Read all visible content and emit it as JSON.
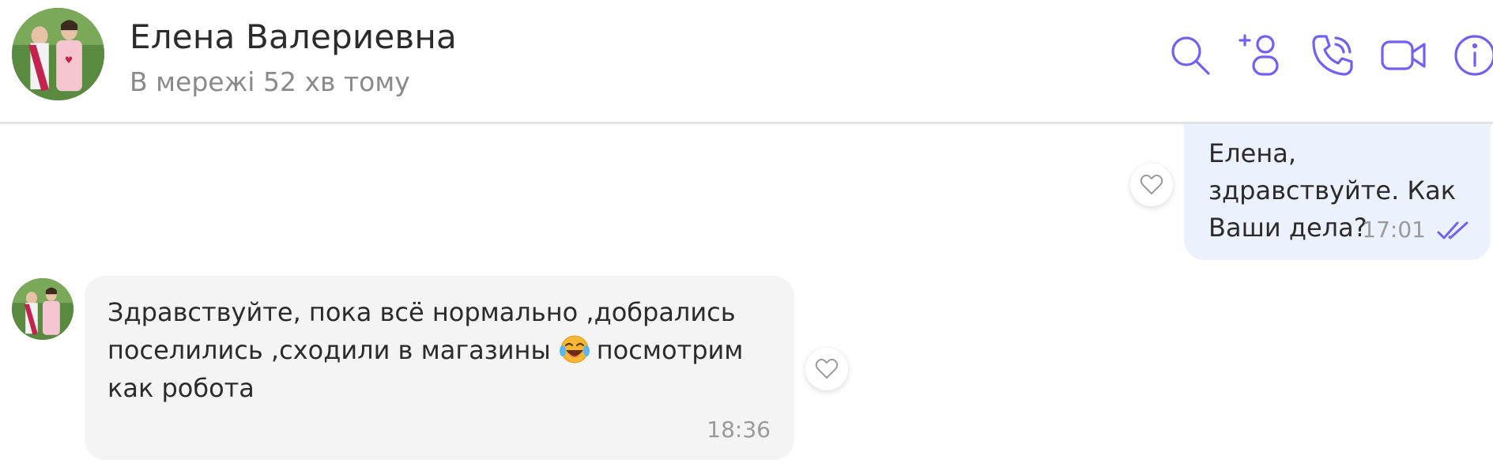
{
  "header": {
    "contact_name": "Елена Валериевна",
    "status": "В мережі 52 хв тому",
    "icons": [
      "search-icon",
      "add-contact-icon",
      "call-icon",
      "video-call-icon",
      "info-icon"
    ]
  },
  "messages": [
    {
      "direction": "outgoing",
      "text": "Елена, здравствуйте. Как Ваши дела?",
      "time": "17:01",
      "status_icon": "double-check-icon"
    },
    {
      "direction": "incoming",
      "text_before_emoji": "Здравствуйте, пока всё нормально ,добрались поселились ,сходили в магазины",
      "emoji": "face-with-tears-of-joy",
      "text_after_emoji": "посмотрим как робота",
      "time": "18:36"
    }
  ],
  "colors": {
    "accent": "#7360f2",
    "outgoing_bubble": "#ebf2fe",
    "incoming_bubble": "#f4f4f4",
    "secondary_text": "#8a8a8a"
  }
}
